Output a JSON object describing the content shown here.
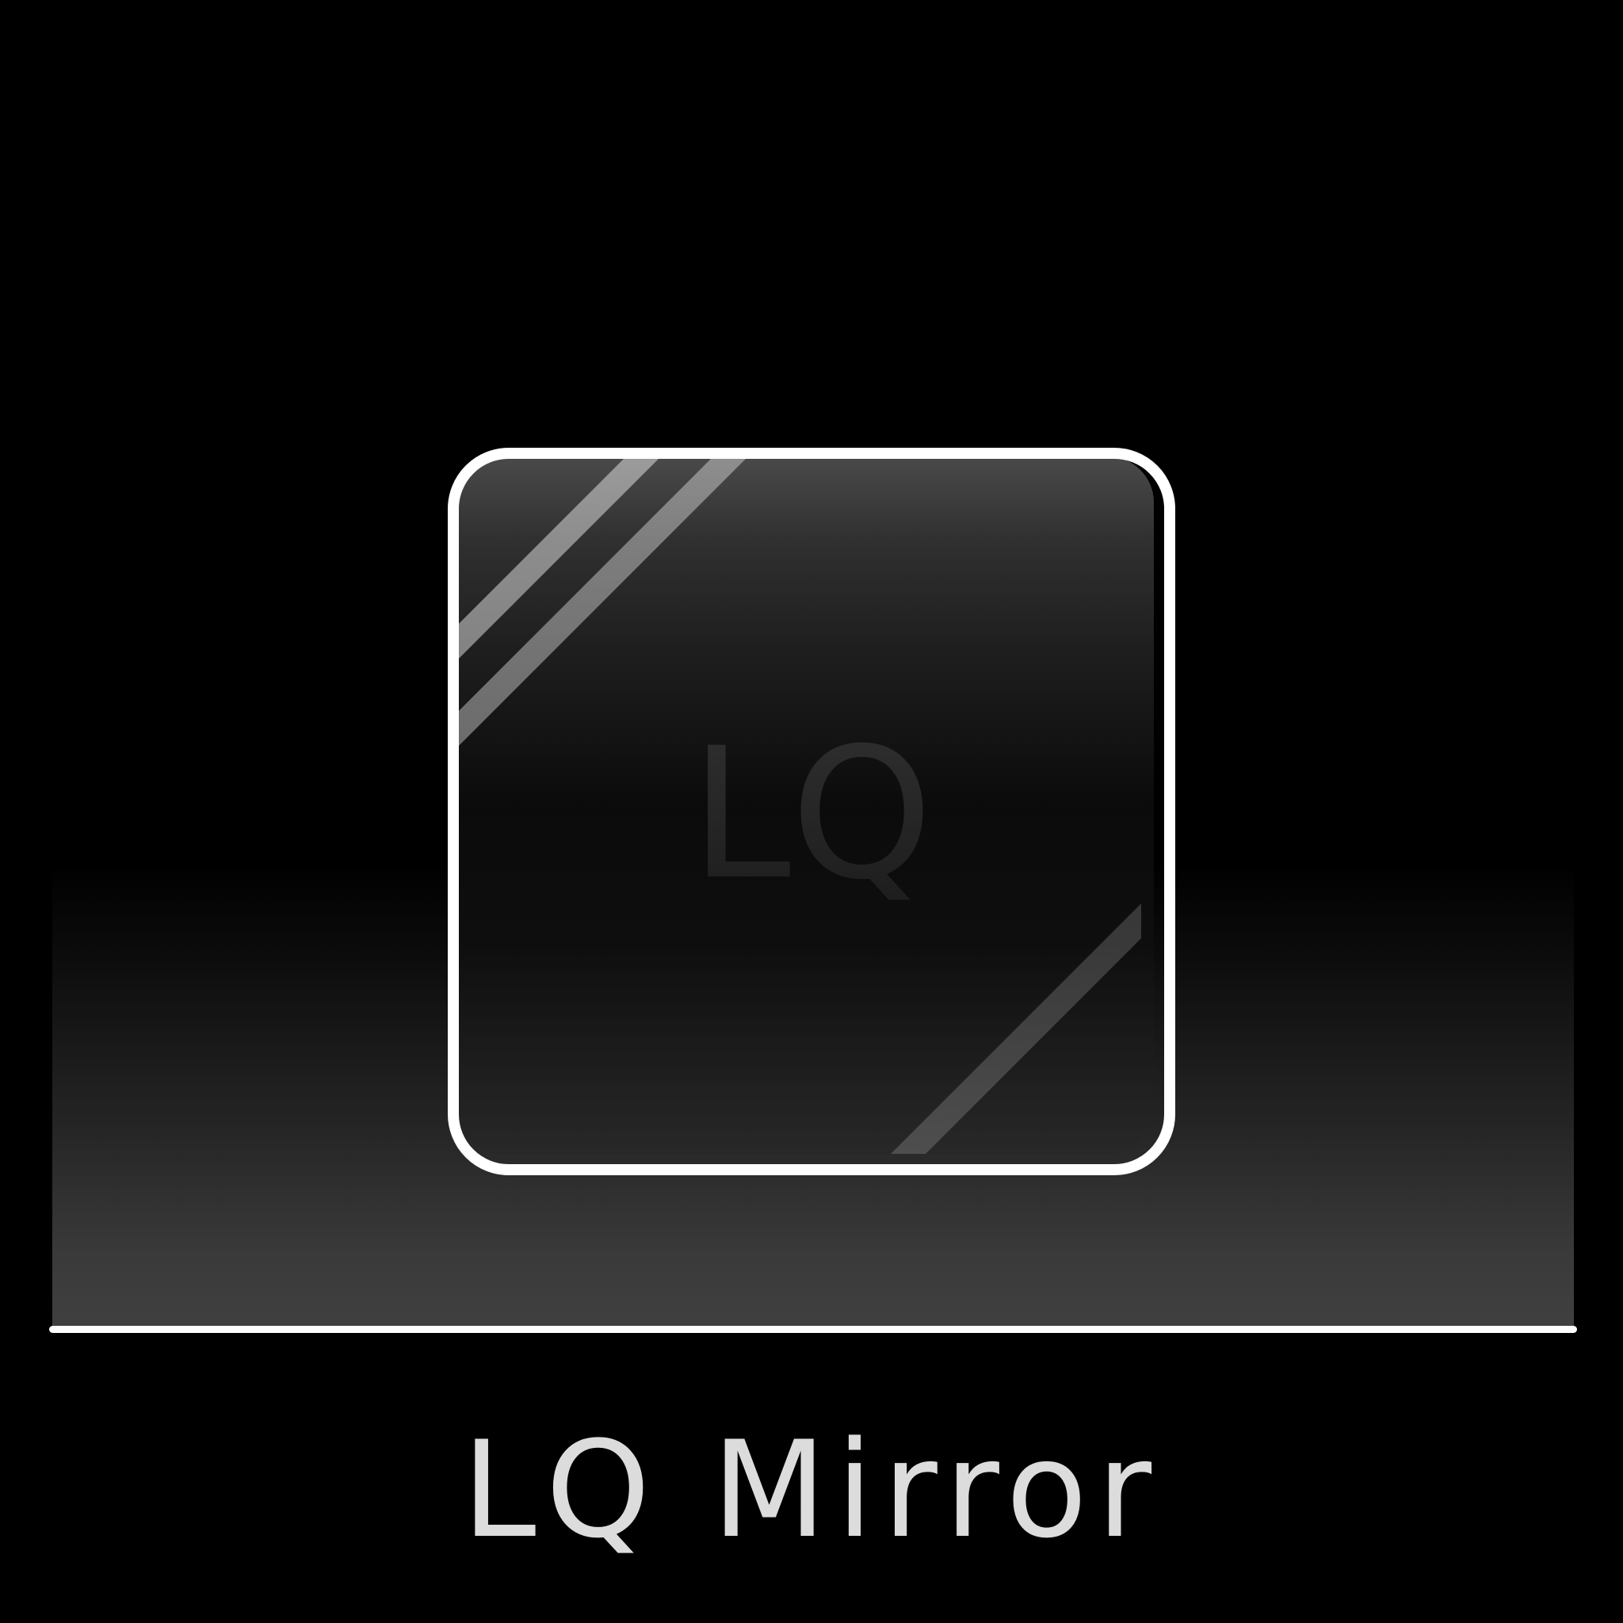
{
  "app": {
    "icon_text": "LQ",
    "name": "LQ Mirror",
    "icon_name": "lq-mirror-app-icon"
  },
  "colors": {
    "background": "#000000",
    "icon_frame": "#ffffff",
    "caption_text": "#dcdcdc",
    "icon_letters": "#262626"
  }
}
